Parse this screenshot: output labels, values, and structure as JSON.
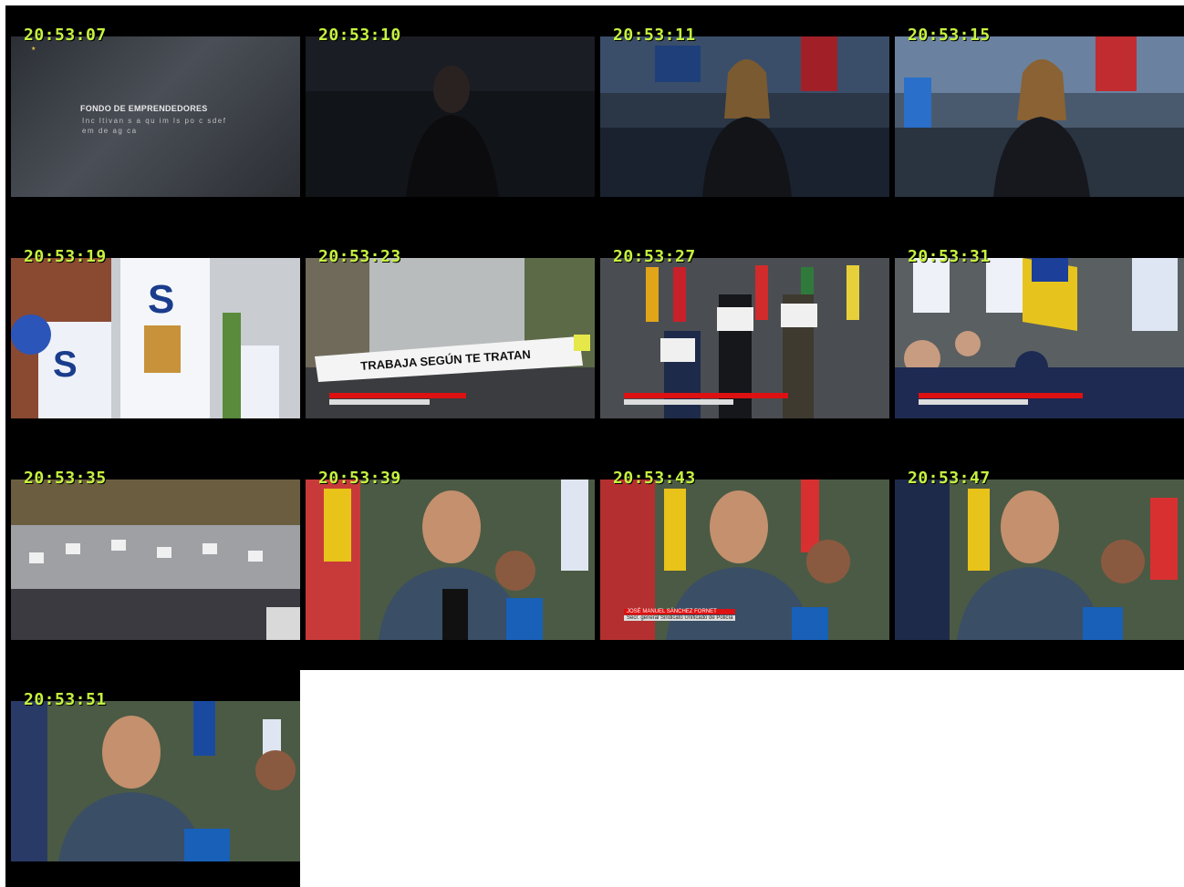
{
  "frames": [
    {
      "timestamp": "20:53:07",
      "scene": "title-card"
    },
    {
      "timestamp": "20:53:10",
      "scene": "studio-dark"
    },
    {
      "timestamp": "20:53:11",
      "scene": "studio"
    },
    {
      "timestamp": "20:53:15",
      "scene": "studio-bright"
    },
    {
      "timestamp": "20:53:19",
      "scene": "banners"
    },
    {
      "timestamp": "20:53:23",
      "scene": "march-banner"
    },
    {
      "timestamp": "20:53:27",
      "scene": "protest-signs"
    },
    {
      "timestamp": "20:53:31",
      "scene": "crowd-flags"
    },
    {
      "timestamp": "20:53:35",
      "scene": "crowd-wide"
    },
    {
      "timestamp": "20:53:39",
      "scene": "interview"
    },
    {
      "timestamp": "20:53:43",
      "scene": "interview"
    },
    {
      "timestamp": "20:53:47",
      "scene": "interview"
    },
    {
      "timestamp": "20:53:51",
      "scene": "interview"
    }
  ],
  "title_card": {
    "heading": "FONDO DE EMPRENDEDORES",
    "subtext": "Inc ltivan s a qu im ls po c sdef em de ag ca"
  },
  "march_banner_text": "TRABAJA SEGÚN TE TRATAN",
  "interview_name": "JOSÉ MANUEL SÁNCHEZ FORNET",
  "interview_role": "Secr. general Sindicato Unificado de Policía",
  "colors": {
    "timestamp": "#c6f23f",
    "background": "#000000",
    "lower_third_red": "#dd1111"
  }
}
